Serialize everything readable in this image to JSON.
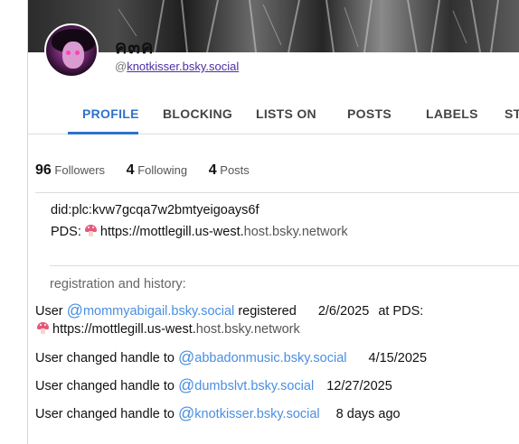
{
  "profile": {
    "display_name": "ค๓ค",
    "handle_prefix": "@",
    "handle": "knotkisser.bsky.social"
  },
  "tabs": [
    "PROFILE",
    "BLOCKING",
    "LISTS ON",
    "POSTS",
    "LABELS",
    "ST"
  ],
  "active_tab": "PROFILE",
  "stats": {
    "followers_count": "96",
    "followers_label": "Followers",
    "following_count": "4",
    "following_label": "Following",
    "posts_count": "4",
    "posts_label": "Posts"
  },
  "identity": {
    "did": "did:plc:kvw7gcqa7w2bmtyeigoays6f",
    "pds_label": "PDS:",
    "pds_icon": "mushroom-icon",
    "pds_host_main": "https://mottlegill.us-west.",
    "pds_host_rest": "host.bsky.network"
  },
  "history": {
    "title": "registration and history:",
    "registered": {
      "prefix": "User",
      "handle": "mommyabigail.bsky.social",
      "verb": "registered",
      "date": "2/6/2025",
      "pds_label": "at PDS:",
      "pds_icon": "mushroom-icon",
      "pds_host_main": "https://mottlegill.us-west.",
      "pds_host_rest": "host.bsky.network"
    },
    "changes": [
      {
        "prefix": "User changed handle to",
        "handle": "abbadonmusic.bsky.social",
        "date": "4/15/2025"
      },
      {
        "prefix": "User changed handle to",
        "handle": "dumbslvt.bsky.social",
        "date": "12/27/2025"
      },
      {
        "prefix": "User changed handle to",
        "handle": "knotkisser.bsky.social",
        "date": "8 days ago"
      }
    ]
  },
  "colors": {
    "accent": "#2e73c9",
    "link": "#4a8fe0",
    "handle_link": "#4b2fa6"
  }
}
